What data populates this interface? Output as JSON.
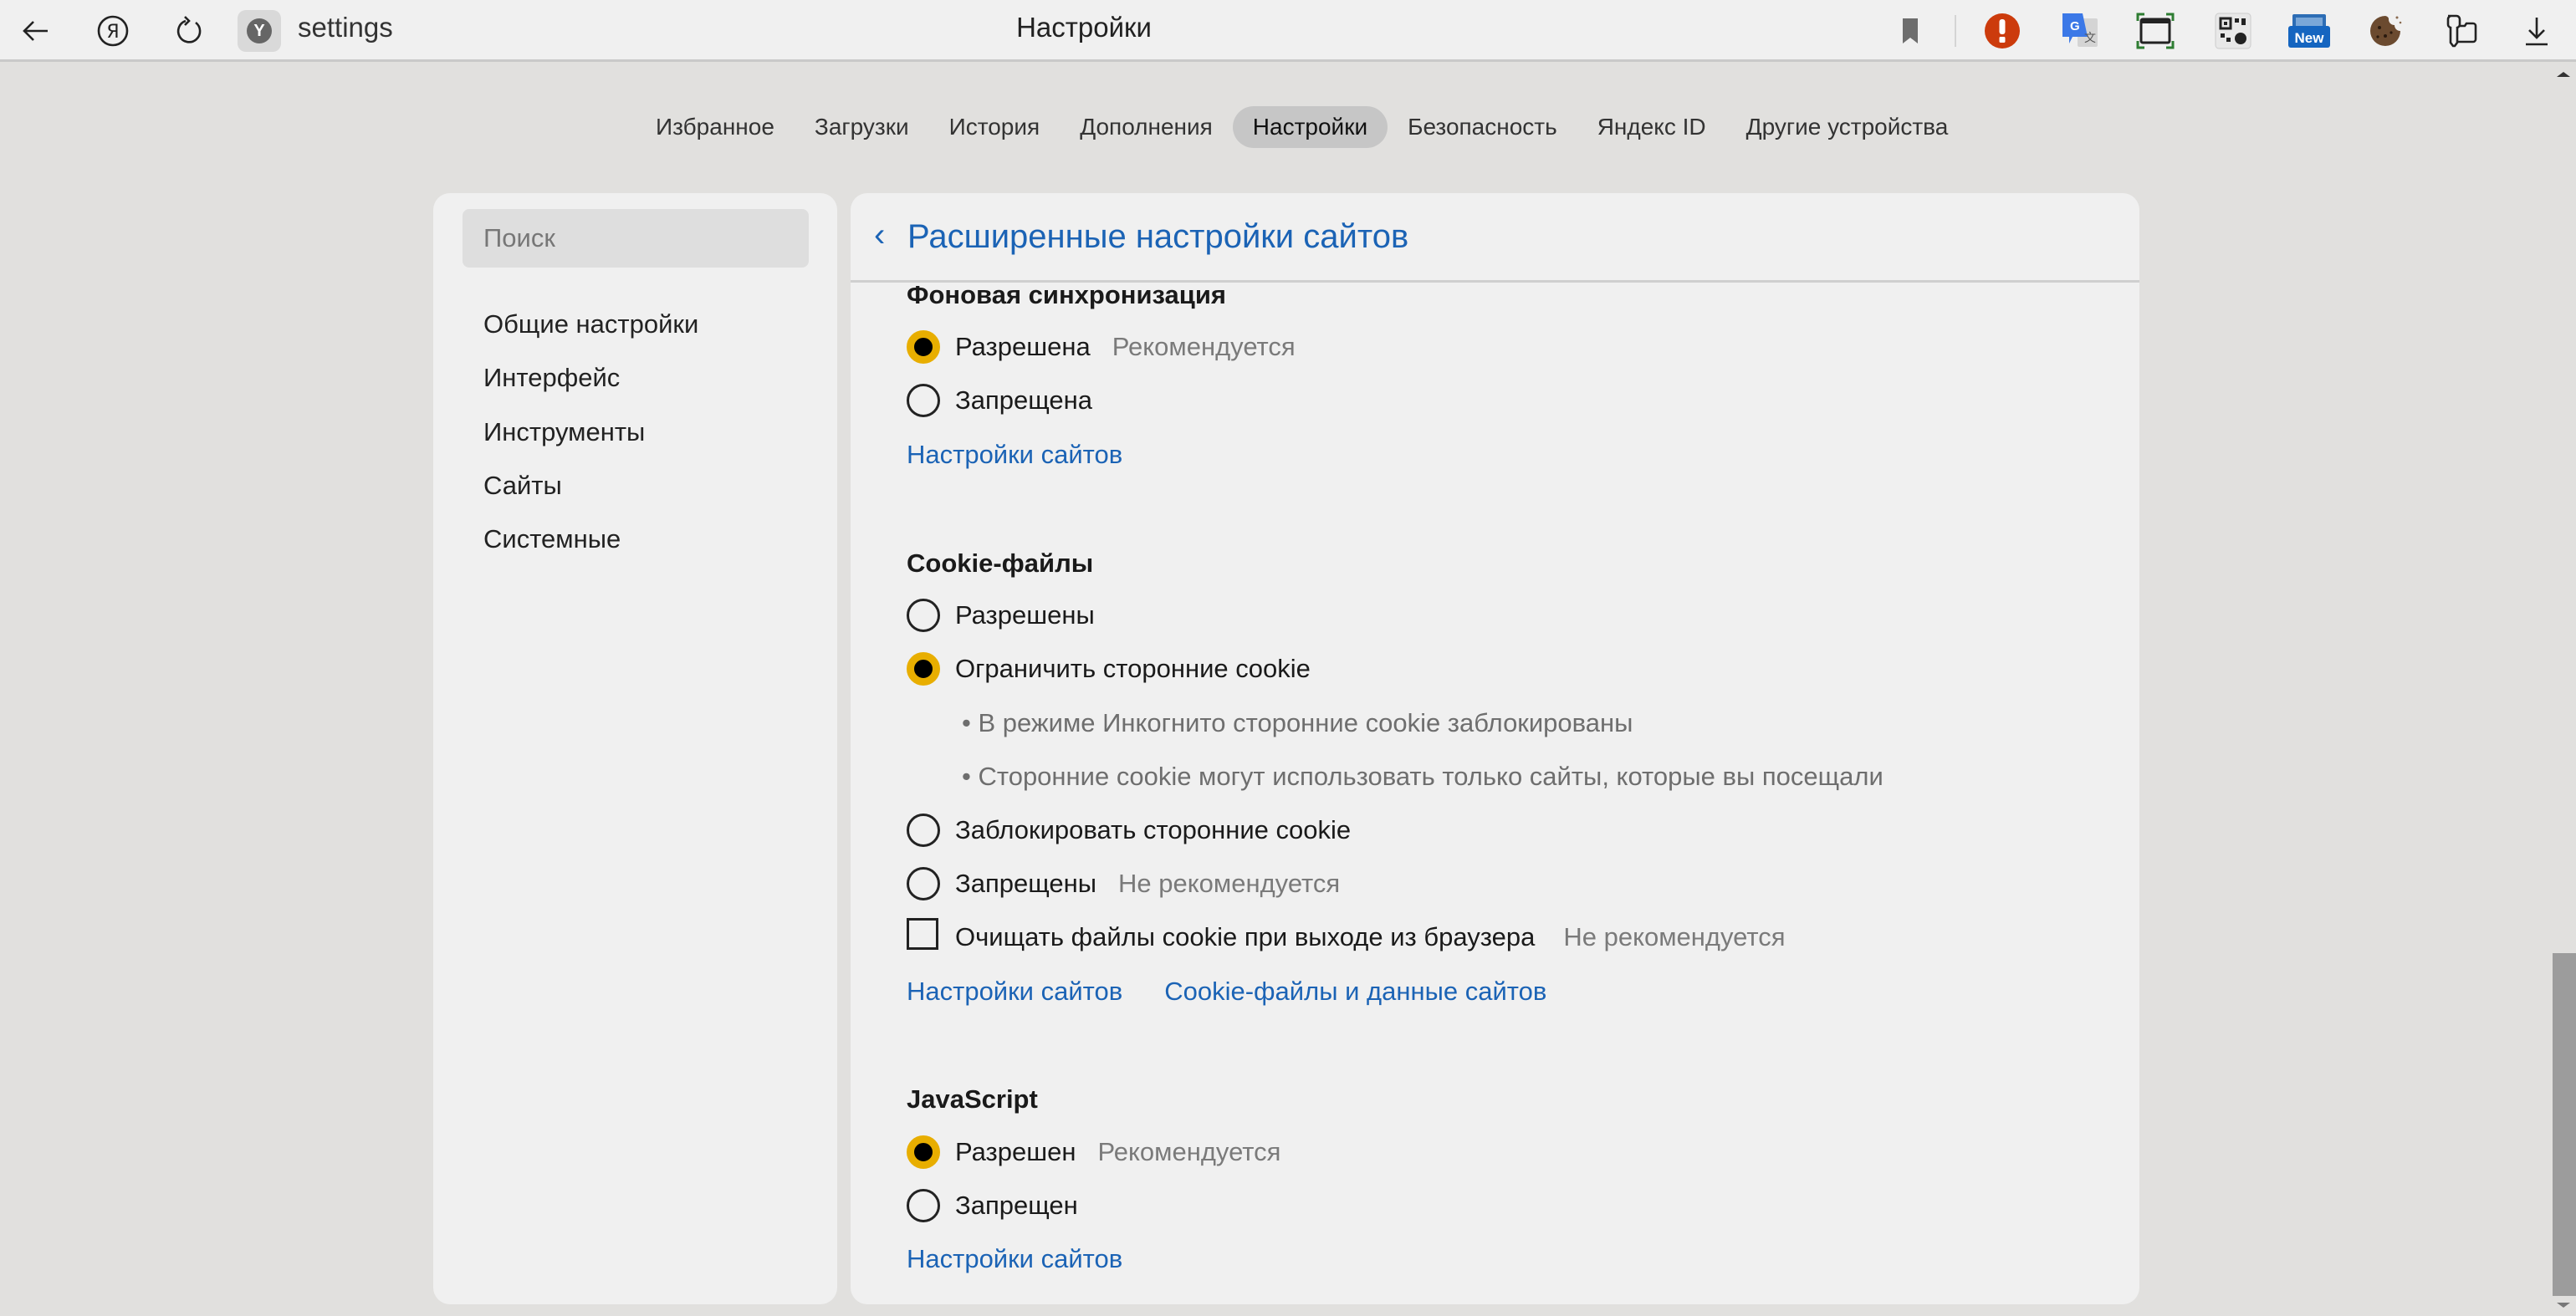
{
  "browser": {
    "address": "settings",
    "page_title": "Настройки",
    "toolbar_icons": [
      "back-icon",
      "yandex-icon",
      "reload-icon",
      "site-icon",
      "bookmark-icon",
      "alert-icon",
      "google-translate-icon",
      "screenshot-icon",
      "qr-code-icon",
      "new-extension-icon",
      "cookie-icon",
      "password-keys-icon",
      "download-icon"
    ],
    "new_badge": "New"
  },
  "nav": {
    "tabs": [
      {
        "label": "Избранное",
        "active": false
      },
      {
        "label": "Загрузки",
        "active": false
      },
      {
        "label": "История",
        "active": false
      },
      {
        "label": "Дополнения",
        "active": false
      },
      {
        "label": "Настройки",
        "active": true
      },
      {
        "label": "Безопасность",
        "active": false
      },
      {
        "label": "Яндекс ID",
        "active": false
      },
      {
        "label": "Другие устройства",
        "active": false
      }
    ]
  },
  "sidebar": {
    "search_placeholder": "Поиск",
    "items": [
      {
        "label": "Общие настройки"
      },
      {
        "label": "Интерфейс"
      },
      {
        "label": "Инструменты"
      },
      {
        "label": "Сайты"
      },
      {
        "label": "Системные"
      }
    ]
  },
  "main": {
    "back_glyph": "‹",
    "title": "Расширенные настройки сайтов",
    "sections": {
      "background_sync": {
        "heading": "Фоновая синхронизация",
        "options": [
          {
            "label": "Разрешена",
            "hint": "Рекомендуется",
            "checked": true
          },
          {
            "label": "Запрещена",
            "hint": "",
            "checked": false
          }
        ],
        "links": [
          "Настройки сайтов"
        ]
      },
      "cookies": {
        "heading": "Cookie-файлы",
        "options": [
          {
            "label": "Разрешены",
            "hint": "",
            "checked": false
          },
          {
            "label": "Ограничить сторонние cookie",
            "hint": "",
            "checked": true
          },
          {
            "label": "Заблокировать сторонние cookie",
            "hint": "",
            "checked": false
          },
          {
            "label": "Запрещены",
            "hint": "Не рекомендуется",
            "checked": false
          }
        ],
        "bullets": [
          "• В режиме Инкогнито сторонние cookie заблокированы",
          "• Сторонние cookie могут использовать только сайты, которые вы посещали"
        ],
        "checkbox": {
          "label": "Очищать файлы cookie при выходе из браузера",
          "hint": "Не рекомендуется",
          "checked": false
        },
        "links": [
          "Настройки сайтов",
          "Cookie-файлы и данные сайтов"
        ]
      },
      "javascript": {
        "heading": "JavaScript",
        "options": [
          {
            "label": "Разрешен",
            "hint": "Рекомендуется",
            "checked": true
          },
          {
            "label": "Запрещен",
            "hint": "",
            "checked": false
          }
        ],
        "links": [
          "Настройки сайтов"
        ]
      }
    }
  },
  "colors": {
    "accent_yellow": "#e8ae00",
    "link_blue": "#1b63b5",
    "page_bg": "#e1e0de",
    "card_bg": "#f0f0f0"
  }
}
